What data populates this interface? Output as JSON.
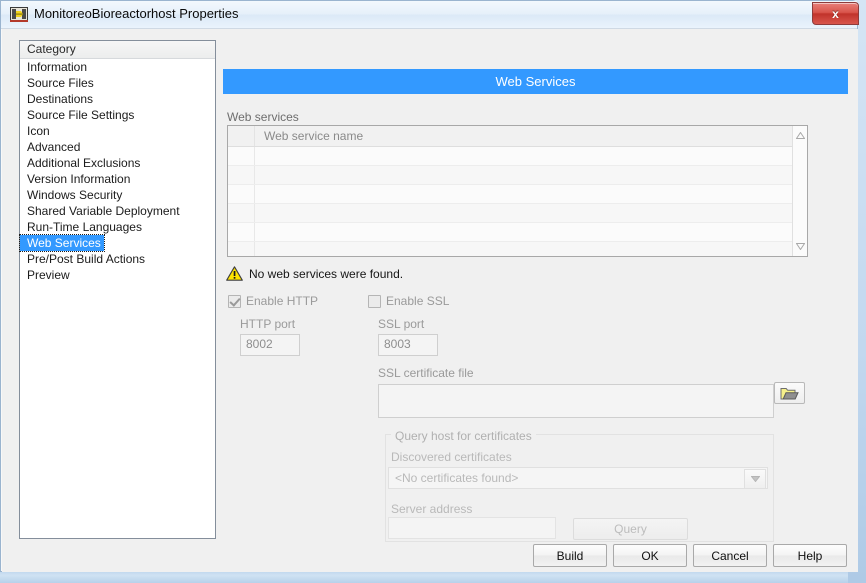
{
  "window": {
    "title": "MonitoreoBioreactorhost Properties",
    "icon": "labview-icon",
    "close_label": "x"
  },
  "category": {
    "header": "Category",
    "items": [
      "Information",
      "Source Files",
      "Destinations",
      "Source File Settings",
      "Icon",
      "Advanced",
      "Additional Exclusions",
      "Version Information",
      "Windows Security",
      "Shared Variable Deployment",
      "Run-Time Languages",
      "Web Services",
      "Pre/Post Build Actions",
      "Preview"
    ],
    "selected": "Web Services"
  },
  "pane": {
    "title": "Web Services",
    "accent_color": "#3399ff"
  },
  "web_services": {
    "label": "Web services",
    "column_header": "Web service name",
    "rows": [],
    "empty_row_count": 6,
    "scroll_up_icon": "triangle-up-icon",
    "scroll_down_icon": "triangle-down-icon"
  },
  "warning": {
    "icon": "warning-triangle-icon",
    "text": "No web services were found.",
    "color": "#ffd700"
  },
  "http": {
    "enable_label": "Enable HTTP",
    "enabled": true,
    "port_label": "HTTP port",
    "port_value": "8002"
  },
  "ssl": {
    "enable_label": "Enable SSL",
    "enabled": false,
    "port_label": "SSL port",
    "port_value": "8003",
    "cert_label": "SSL certificate file",
    "cert_value": "",
    "browse_icon": "folder-open-icon"
  },
  "query_group": {
    "title": "Query host for certificates",
    "discovered_label": "Discovered certificates",
    "discovered_value": "<No certificates found>",
    "dropdown_icon": "chevron-down-icon",
    "server_label": "Server address",
    "server_value": "",
    "query_button": "Query"
  },
  "footer": {
    "build": "Build",
    "ok": "OK",
    "cancel": "Cancel",
    "help": "Help"
  }
}
